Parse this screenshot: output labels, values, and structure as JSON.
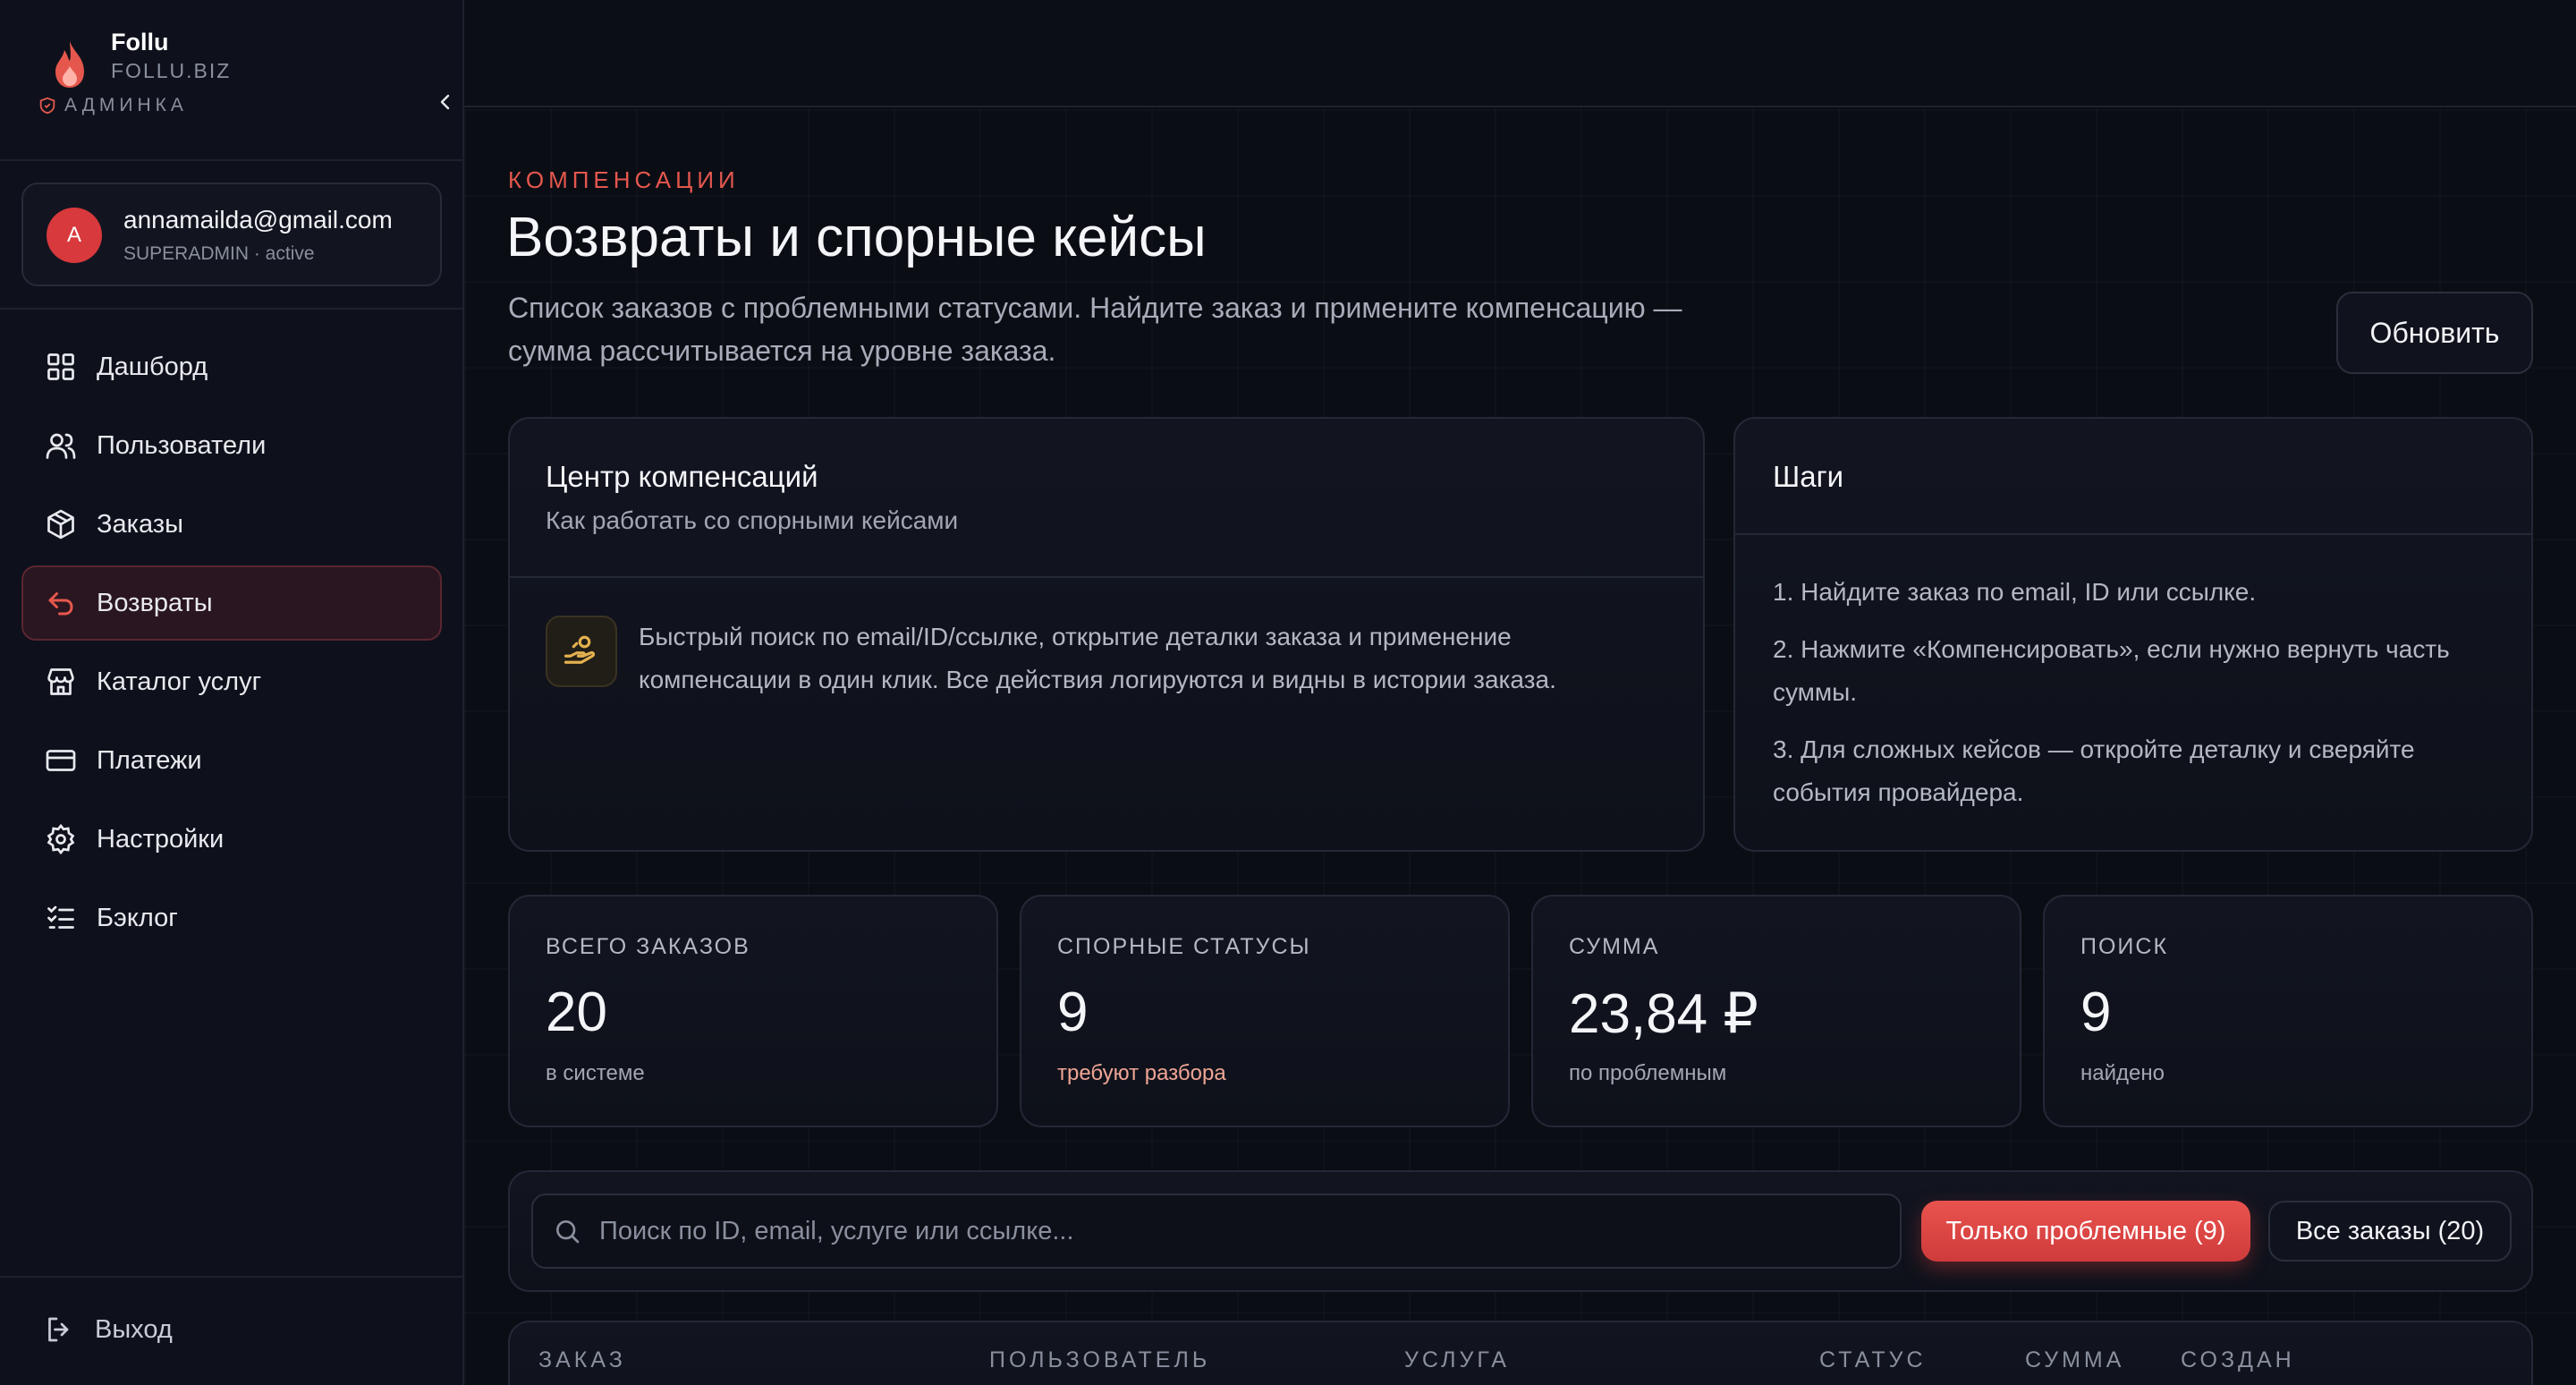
{
  "brand": {
    "name": "Follu",
    "domain": "FOLLU.BIZ",
    "role": "АДМИНКА",
    "accent": "#e5574d"
  },
  "user": {
    "avatar_letter": "A",
    "email": "annamailda@gmail.com",
    "meta": "SUPERADMIN · active"
  },
  "nav": {
    "items": [
      {
        "label": "Дашборд",
        "icon": "grid-icon"
      },
      {
        "label": "Пользователи",
        "icon": "users-icon"
      },
      {
        "label": "Заказы",
        "icon": "box-icon"
      },
      {
        "label": "Возвраты",
        "icon": "return-arrow-icon",
        "active": true
      },
      {
        "label": "Каталог услуг",
        "icon": "store-icon"
      },
      {
        "label": "Платежи",
        "icon": "credit-card-icon"
      },
      {
        "label": "Настройки",
        "icon": "gear-icon"
      },
      {
        "label": "Бэклог",
        "icon": "checklist-icon"
      }
    ],
    "logout": "Выход"
  },
  "page": {
    "eyebrow": "КОМПЕНСАЦИИ",
    "title": "Возвраты и спорные кейсы",
    "description": "Список заказов с проблемными статусами. Найдите заказ и примените компенсацию — сумма рассчитывается на уровне заказа.",
    "refresh_label": "Обновить"
  },
  "center": {
    "title": "Центр компенсаций",
    "subtitle": "Как работать со спорными кейсами",
    "text": "Быстрый поиск по email/ID/ссылке, открытие деталки заказа и применение компенсации в один клик. Все действия логируются и видны в истории заказа."
  },
  "steps": {
    "title": "Шаги",
    "items": [
      "1. Найдите заказ по email, ID или ссылке.",
      "2. Нажмите «Компенсировать», если нужно вернуть часть суммы.",
      "3. Для сложных кейсов — откройте деталку и сверяйте события провайдера."
    ]
  },
  "stats": [
    {
      "label": "ВСЕГО ЗАКАЗОВ",
      "value": "20",
      "sub": "в системе"
    },
    {
      "label": "СПОРНЫЕ СТАТУСЫ",
      "value": "9",
      "sub": "требуют разбора"
    },
    {
      "label": "СУММА",
      "value": "23,84 ₽",
      "sub": "по проблемным"
    },
    {
      "label": "ПОИСК",
      "value": "9",
      "sub": "найдено"
    }
  ],
  "search": {
    "placeholder": "Поиск по ID, email, услуге или ссылке...",
    "value": "",
    "filter_problem": "Только проблемные (9)",
    "filter_all": "Все заказы (20)"
  },
  "table": {
    "columns": [
      "ЗАКАЗ",
      "ПОЛЬЗОВАТЕЛЬ",
      "УСЛУГА",
      "СТАТУС",
      "СУММА",
      "СОЗДАН"
    ]
  }
}
